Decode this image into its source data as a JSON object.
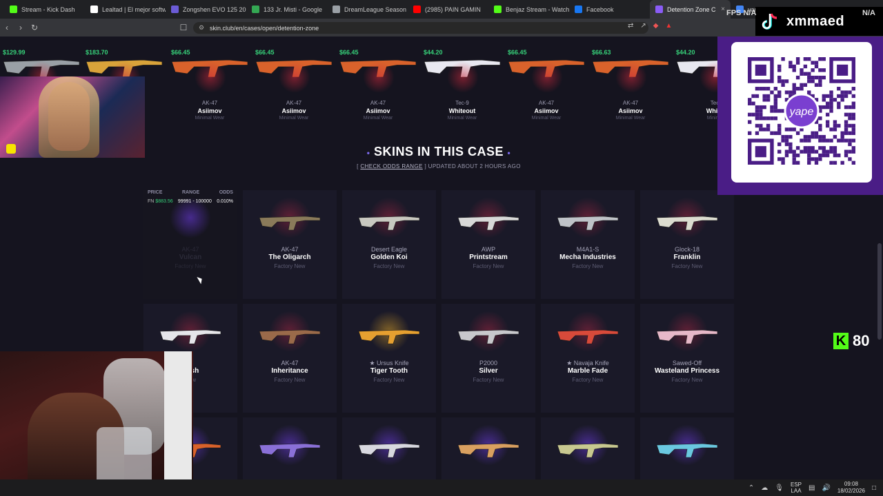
{
  "tabs": [
    {
      "label": "Stream - Kick Dash",
      "color": "#53fc18"
    },
    {
      "label": "Lealtad | El mejor softw",
      "color": "#ffffff"
    },
    {
      "label": "Zongshen EVO 125 20",
      "color": "#6b5bd6"
    },
    {
      "label": "133 Jr. Misti - Google",
      "color": "#34a853"
    },
    {
      "label": "DreamLeague Season",
      "color": "#9aa0a6"
    },
    {
      "label": "(2985) PAIN GAMIN",
      "color": "#ff0000"
    },
    {
      "label": "Benjaz Stream - Watch",
      "color": "#53fc18"
    },
    {
      "label": "Facebook",
      "color": "#1877f2"
    },
    {
      "label": "Detention Zone C",
      "color": "#8a5cf6",
      "active": true
    },
    {
      "label": "vanity - Me",
      "color": "#4285f4"
    }
  ],
  "address": {
    "url": "skin.club/en/cases/open/detention-zone"
  },
  "recent_drops": [
    {
      "price": "$129.99",
      "weapon": "",
      "name": "",
      "quality": ""
    },
    {
      "price": "$183.70",
      "weapon": "",
      "name": "",
      "quality": ""
    },
    {
      "price": "$66.45",
      "weapon": "AK-47",
      "name": "Asiimov",
      "quality": "Minimal Wear"
    },
    {
      "price": "$66.45",
      "weapon": "AK-47",
      "name": "Asiimov",
      "quality": "Minimal Wear"
    },
    {
      "price": "$66.45",
      "weapon": "AK-47",
      "name": "Asiimov",
      "quality": "Minimal Wear"
    },
    {
      "price": "$44.20",
      "weapon": "Tec-9",
      "name": "Whiteout",
      "quality": "Minimal Wear"
    },
    {
      "price": "$66.45",
      "weapon": "AK-47",
      "name": "Asiimov",
      "quality": "Minimal Wear"
    },
    {
      "price": "$66.63",
      "weapon": "AK-47",
      "name": "Asiimov",
      "quality": "Minimal Wear"
    },
    {
      "price": "$44.20",
      "weapon": "Tec",
      "name": "White",
      "quality": "Minima"
    }
  ],
  "section": {
    "title": "SKINS IN THIS CASE",
    "sub_left": "[",
    "sub_link": "CHECK ODDS RANGE",
    "sub_right": "] UPDATED ABOUT 2 HOURS AGO"
  },
  "odds_panel": {
    "headers": [
      "PRICE",
      "RANGE",
      "ODDS"
    ],
    "fn": "FN",
    "price": "$883.56",
    "range": "99991 - 100000",
    "odds": "0.010%"
  },
  "skins_row1": [
    {
      "weapon": "AK-47",
      "name": "Vulcan",
      "quality": "Factory New",
      "glow": "purple"
    },
    {
      "weapon": "AK-47",
      "name": "The Oligarch",
      "quality": "Factory New",
      "glow": "red"
    },
    {
      "weapon": "Desert Eagle",
      "name": "Golden Koi",
      "quality": "Factory New",
      "glow": "red"
    },
    {
      "weapon": "AWP",
      "name": "Printstream",
      "quality": "Factory New",
      "glow": "red"
    },
    {
      "weapon": "M4A1-S",
      "name": "Mecha Industries",
      "quality": "Factory New",
      "glow": "red"
    },
    {
      "weapon": "Glock-18",
      "name": "Franklin",
      "quality": "Factory New",
      "glow": "red"
    }
  ],
  "skins_row2": [
    {
      "weapon": "-S",
      "name": "Rash",
      "quality": "New",
      "glow": "red"
    },
    {
      "weapon": "AK-47",
      "name": "Inheritance",
      "quality": "Factory New",
      "glow": "red"
    },
    {
      "weapon": "★ Ursus Knife",
      "name": "Tiger Tooth",
      "quality": "Factory New",
      "glow": "gold"
    },
    {
      "weapon": "P2000",
      "name": "Silver",
      "quality": "Factory New",
      "glow": "red"
    },
    {
      "weapon": "★ Navaja Knife",
      "name": "Marble Fade",
      "quality": "Factory New",
      "glow": "red"
    },
    {
      "weapon": "Sawed-Off",
      "name": "Wasteland Princess",
      "quality": "Factory New",
      "glow": "red"
    }
  ],
  "overlay": {
    "tiktok_handle": "xmmaed",
    "kick_count": "80",
    "fps": "FPS N/A",
    "na": "N/A"
  },
  "taskbar": {
    "lang_top": "ESP",
    "lang_bottom": "LAA",
    "time": "09:08",
    "date": "18/02/2026"
  }
}
